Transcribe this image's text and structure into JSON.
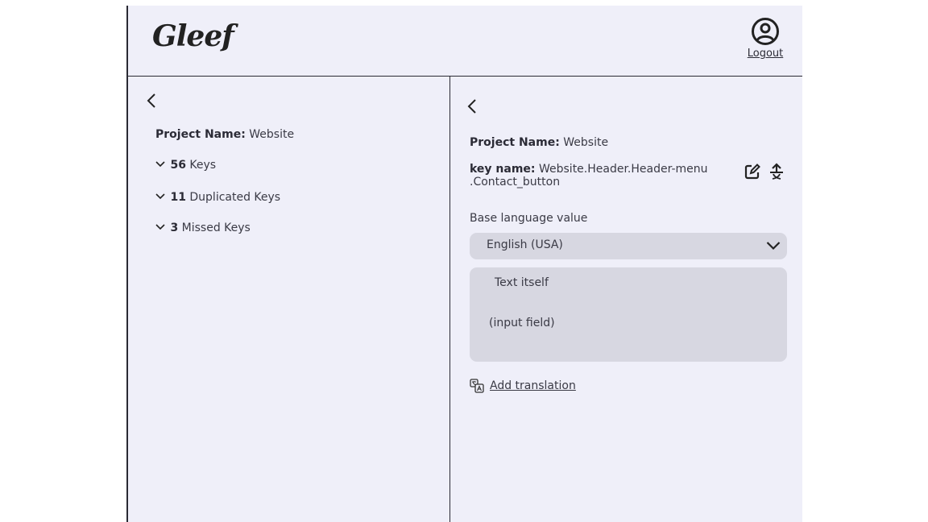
{
  "header": {
    "logo": "Gleef",
    "logout_label": "Logout"
  },
  "left_panel": {
    "project_label": "Project Name:",
    "project_value": "Website",
    "items": [
      {
        "count": "56",
        "label": "Keys"
      },
      {
        "count": "11",
        "label": "Duplicated Keys"
      },
      {
        "count": "3",
        "label": "Missed Keys"
      }
    ]
  },
  "right_panel": {
    "project_label": "Project Name:",
    "project_value": "Website",
    "key_label": "key name:",
    "key_value": "Website.Header.Header-menu .Contact_button",
    "base_language_label": "Base language value",
    "language_selected": "English (USA)",
    "text_line1": "Text itself",
    "text_line2": "(input field)",
    "add_translation": "Add translation"
  },
  "icons": [
    "back-icon",
    "user-circle-icon",
    "chevron-down-icon",
    "edit-icon",
    "translate-upload-icon",
    "translate-icon"
  ],
  "colors": {
    "panel_bg": "#efeff9",
    "field_bg": "#d7d7e1",
    "border": "#2a2a33",
    "text": "#2b2b36"
  }
}
